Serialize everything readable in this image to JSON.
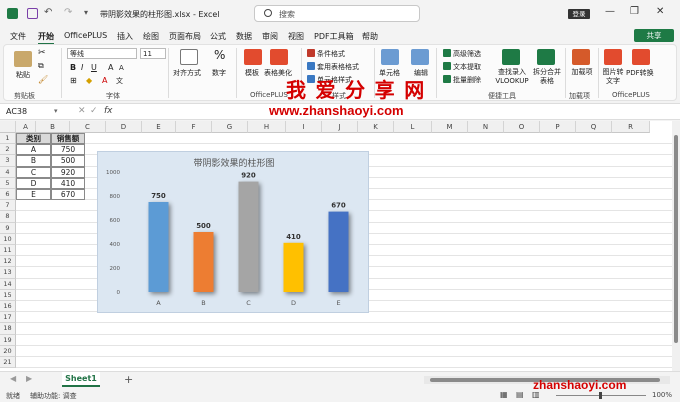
{
  "window": {
    "title": "带阴影效果的柱形图.xlsx - Excel",
    "search_placeholder": "搜索",
    "login": "登录"
  },
  "tabs": [
    "文件",
    "开始",
    "OfficePLUS",
    "插入",
    "绘图",
    "页面布局",
    "公式",
    "数据",
    "审阅",
    "视图",
    "PDF工具箱",
    "帮助"
  ],
  "share": "共享",
  "ribbon": {
    "paste": "粘贴",
    "clipboard": "剪贴板",
    "font_name": "等线",
    "font_size": "11",
    "font": "字体",
    "alignment": "对齐方式",
    "number": "数字",
    "template": "模板",
    "table_beautify": "表格美化",
    "officeplus": "OfficePLUS",
    "cond_format": "条件格式",
    "table_format": "套用表格格式",
    "cell_style": "单元格样式",
    "styles": "样式",
    "cells": "单元格",
    "editing": "编辑",
    "adv_filter": "高级筛选",
    "text_extract": "文本提取",
    "batch_delete": "批量删除",
    "lookup": "查找录入 VLOOKUP",
    "split_merge": "拆分合并 表格",
    "convenience": "便捷工具",
    "addins": "加载项",
    "addins_group": "加载项",
    "img_to_text": "图片转 文字",
    "pdf_convert": "PDF转换",
    "officeplus2": "OfficePLUS"
  },
  "formula_bar": {
    "name_box": "AC38",
    "fx": "fx",
    "value": ""
  },
  "columns": [
    "A",
    "B",
    "C",
    "D",
    "E",
    "F",
    "G",
    "H",
    "I",
    "J",
    "K",
    "L",
    "M",
    "N",
    "O",
    "P",
    "Q",
    "R"
  ],
  "rows": [
    "1",
    "2",
    "3",
    "4",
    "5",
    "6",
    "7",
    "8",
    "9",
    "10",
    "11",
    "12",
    "13",
    "14",
    "15",
    "16",
    "17",
    "18",
    "19",
    "20",
    "21"
  ],
  "table": {
    "headers": [
      "类别",
      "销售额"
    ],
    "rows": [
      [
        "A",
        "750"
      ],
      [
        "B",
        "500"
      ],
      [
        "C",
        "920"
      ],
      [
        "D",
        "410"
      ],
      [
        "E",
        "670"
      ]
    ]
  },
  "chart_data": {
    "type": "bar",
    "title": "带阴影效果的柱形图",
    "categories": [
      "A",
      "B",
      "C",
      "D",
      "E"
    ],
    "values": [
      750,
      500,
      920,
      410,
      670
    ],
    "colors": [
      "#5b9bd5",
      "#ed7d31",
      "#a5a5a5",
      "#ffc000",
      "#4472c4"
    ],
    "ylim": [
      0,
      1000
    ],
    "yticks": [
      0,
      200,
      400,
      600,
      800,
      1000
    ],
    "grid": false,
    "legend": "none",
    "background": "#dce7f2"
  },
  "sheet_tab": "Sheet1",
  "status": {
    "ready": "就绪",
    "accessibility": "辅助功能: 调查",
    "zoom": "100%"
  },
  "watermark": {
    "cn": "我 爱 分 享 网",
    "url": "www.zhanshaoyi.com",
    "url2": "zhanshaoyi.com"
  }
}
